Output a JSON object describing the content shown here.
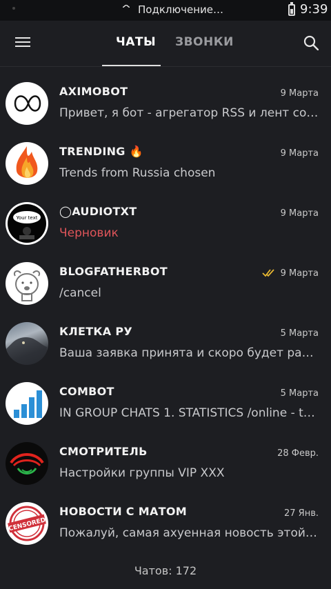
{
  "status_bar": {
    "connection": "Подключение…",
    "time": "9:39"
  },
  "header": {
    "tabs": [
      "ЧАТЫ",
      "ЗВОНКИ"
    ]
  },
  "chats": [
    {
      "name": "AXIMOBOT",
      "date": "9 Марта",
      "preview": "Привет, я бот - агрегатор RSS и лент соц…",
      "avatar": "infinity-logo-avatar"
    },
    {
      "name": "TRENDING 🔥",
      "date": "9 Марта",
      "preview": "Trends from Russia chosen",
      "avatar": "flame-avatar"
    },
    {
      "name": "◯AUDIOTXT",
      "date": "9 Марта",
      "preview": "Черновик",
      "avatar": "your-text-avatar",
      "avatar_text": "Your text",
      "draft": true
    },
    {
      "name": "BLOGFATHERBOT",
      "date": "9 Марта",
      "preview": "/cancel",
      "avatar": "dog-avatar",
      "read": true
    },
    {
      "name": "КЛЕТКА РУ",
      "date": "5 Марта",
      "preview": "Ваша заявка принята и скоро будет рас…",
      "avatar": "wolf-photo-avatar"
    },
    {
      "name": "COMBOT",
      "date": "5 Марта",
      "preview": "IN GROUP CHATS 1. STATISTICS /online - t…",
      "avatar": "bar-chart-avatar"
    },
    {
      "name": "СМОТРИТЕЛЬ",
      "date": "28 Февр.",
      "preview": "Настройки группы VIP XXX",
      "avatar": "eye-avatar"
    },
    {
      "name": "НОВОСТИ С МАТОМ",
      "date": "27 Янв.",
      "preview": "Пожалуй, самая ахуенная новость этой…",
      "avatar": "censored-stamp-avatar",
      "avatar_text": "CENSORED"
    }
  ],
  "footer": {
    "chat_count": "Чатов: 172"
  },
  "colors": {
    "background": "#1d1e22",
    "status_bar": "#101113",
    "draft": "#e0555a",
    "read_ticks": "#e8b832"
  }
}
